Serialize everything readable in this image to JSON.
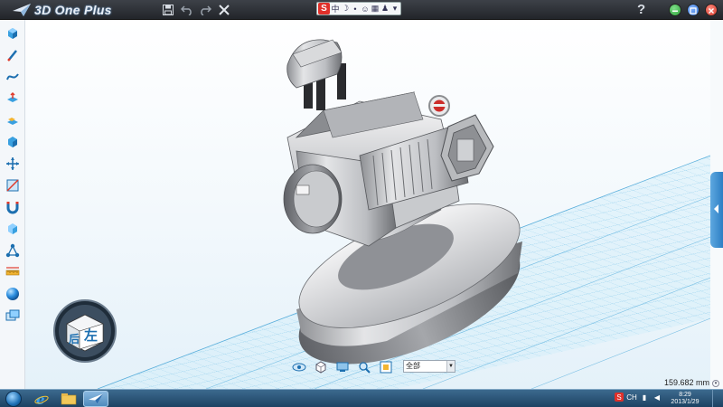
{
  "titlebar": {
    "app_title": "3D One Plus",
    "quick_actions": [
      {
        "name": "save",
        "icon": "save-icon"
      },
      {
        "name": "undo",
        "icon": "undo-icon"
      },
      {
        "name": "redo",
        "icon": "redo-icon"
      },
      {
        "name": "close-doc",
        "icon": "close-icon"
      }
    ],
    "ime": {
      "logo": "S",
      "mode": "中"
    },
    "help": "?",
    "window_buttons": [
      {
        "name": "minimize",
        "color": "#2fa23a"
      },
      {
        "name": "restore",
        "color": "#2f6fd0"
      },
      {
        "name": "close",
        "color": "#d2382c"
      }
    ]
  },
  "left_toolbar": [
    "primitive-solid-icon",
    "sketch-pen-icon",
    "curve-icon",
    "special-feature-icon",
    "feature-modify-icon",
    "basic-edit-icon",
    "move-icon",
    "combine-icon",
    "magnet-icon",
    "material-cube-icon",
    "assembly-icon",
    "distance-measure-icon",
    "color-sphere-icon",
    "component-library-icon"
  ],
  "viewcube": {
    "back_label": "后",
    "left_label": "左"
  },
  "bottom_toolbar": {
    "icons": [
      "view-eye-icon",
      "render-mode-icon",
      "view-plane-icon",
      "zoom-icon",
      "fit-view-icon"
    ],
    "layer_value": "全部"
  },
  "status": {
    "measure": "159.682 mm"
  },
  "taskbar": {
    "clock_time": "8:29",
    "clock_date": "2013/1/29",
    "tray_ime": "S",
    "tray_lang": "CH"
  }
}
